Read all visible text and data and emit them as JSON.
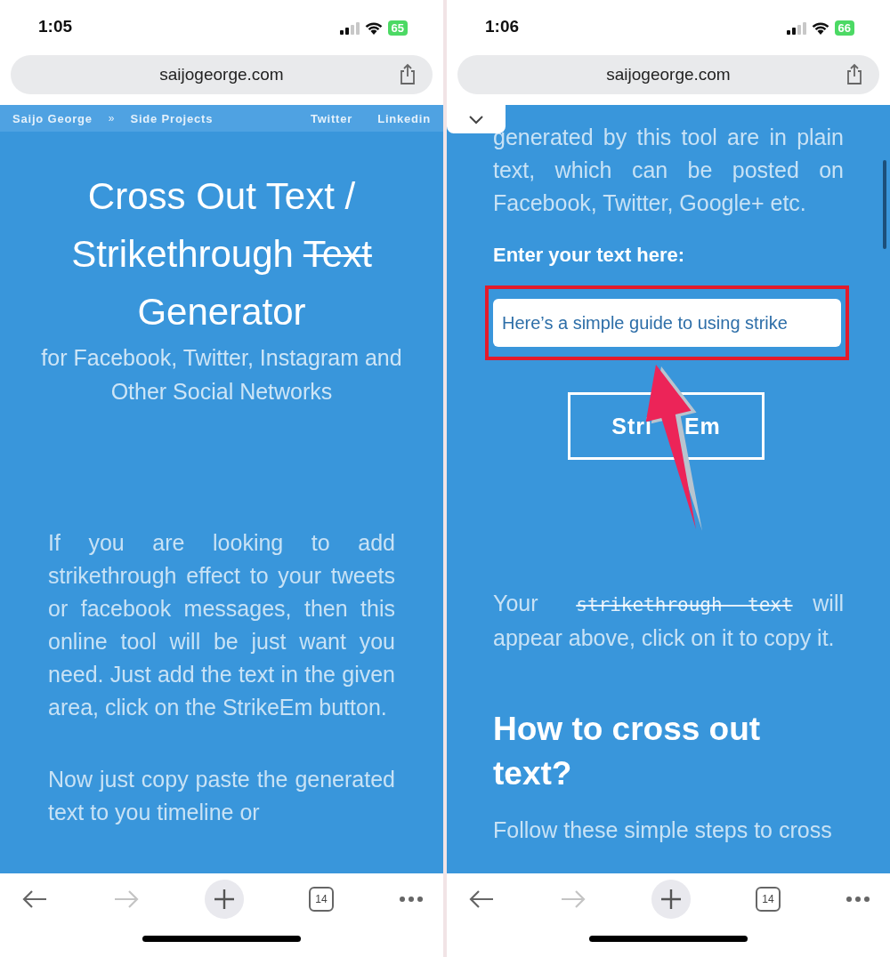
{
  "phones": [
    {
      "status_bar": {
        "time": "1:05",
        "battery": "65"
      },
      "url": "saijogeorge.com",
      "scrolled": false,
      "pointer_arrow": false,
      "blocks": [
        {
          "kind": "nav",
          "crumbs": [
            "Saijo George",
            "Side Projects"
          ],
          "separator": "»",
          "links": [
            "Twitter",
            "Linkedin"
          ]
        },
        {
          "kind": "title",
          "before": "Cross Out Text / Strikethrough",
          "struck": "Text",
          "after": "Generator"
        },
        {
          "kind": "subtitle",
          "text": "for Facebook, Twitter, Instagram and Other Social Networks"
        },
        {
          "kind": "paragraph",
          "text": "If you are looking to add strikethrough effect to your tweets or facebook messages, then this online tool will be just want you need. Just add the text in the given area, click on the StrikeEm button."
        },
        {
          "kind": "paragraph",
          "text": "Now just copy paste the generated text to you timeline or"
        }
      ],
      "toolbar": {
        "tabs": "14",
        "forward_disabled": true
      }
    },
    {
      "status_bar": {
        "time": "1:06",
        "battery": "66"
      },
      "url": "saijogeorge.com",
      "scrolled": true,
      "pointer_arrow": true,
      "blocks": [
        {
          "kind": "collapse_tab"
        },
        {
          "kind": "paragraph",
          "text": "generated by this tool are in plain text, which can be posted on Facebook, Twitter, Google+ etc."
        },
        {
          "kind": "label",
          "text": "Enter your text here:"
        },
        {
          "kind": "input",
          "value": "Here’s a simple guide to using strike",
          "highlighted": true
        },
        {
          "kind": "button",
          "visible_parts": [
            "Stri",
            "Em"
          ]
        },
        {
          "kind": "note",
          "before": "Your",
          "struck": "strikethrough text",
          "after": "will appear above, click on it to copy it."
        },
        {
          "kind": "heading",
          "text": "How to cross out text?"
        },
        {
          "kind": "paragraph",
          "text": "Follow these simple steps to cross"
        }
      ],
      "toolbar": {
        "tabs": "14",
        "forward_disabled": true
      }
    }
  ]
}
